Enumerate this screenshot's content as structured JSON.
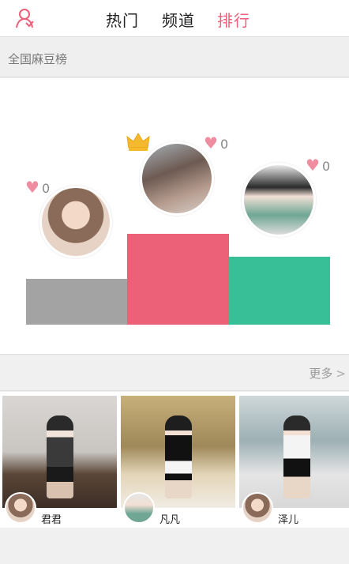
{
  "header": {
    "tabs": [
      {
        "label": "热门",
        "active": false
      },
      {
        "label": "频道",
        "active": false
      },
      {
        "label": "排行",
        "active": true
      }
    ],
    "accent_color": "#ec5f78"
  },
  "section": {
    "title": "全国麻豆榜"
  },
  "podium": {
    "colors": {
      "left": "#a3a3a3",
      "middle": "#ec6178",
      "right": "#38bf97"
    },
    "entries": [
      {
        "position": "left",
        "likes": "0"
      },
      {
        "position": "middle",
        "likes": "0",
        "crowned": true
      },
      {
        "position": "right",
        "likes": "0"
      }
    ]
  },
  "more": {
    "label": "更多"
  },
  "cards": [
    {
      "name": "君君"
    },
    {
      "name": "凡凡"
    },
    {
      "name": "泽儿"
    }
  ]
}
